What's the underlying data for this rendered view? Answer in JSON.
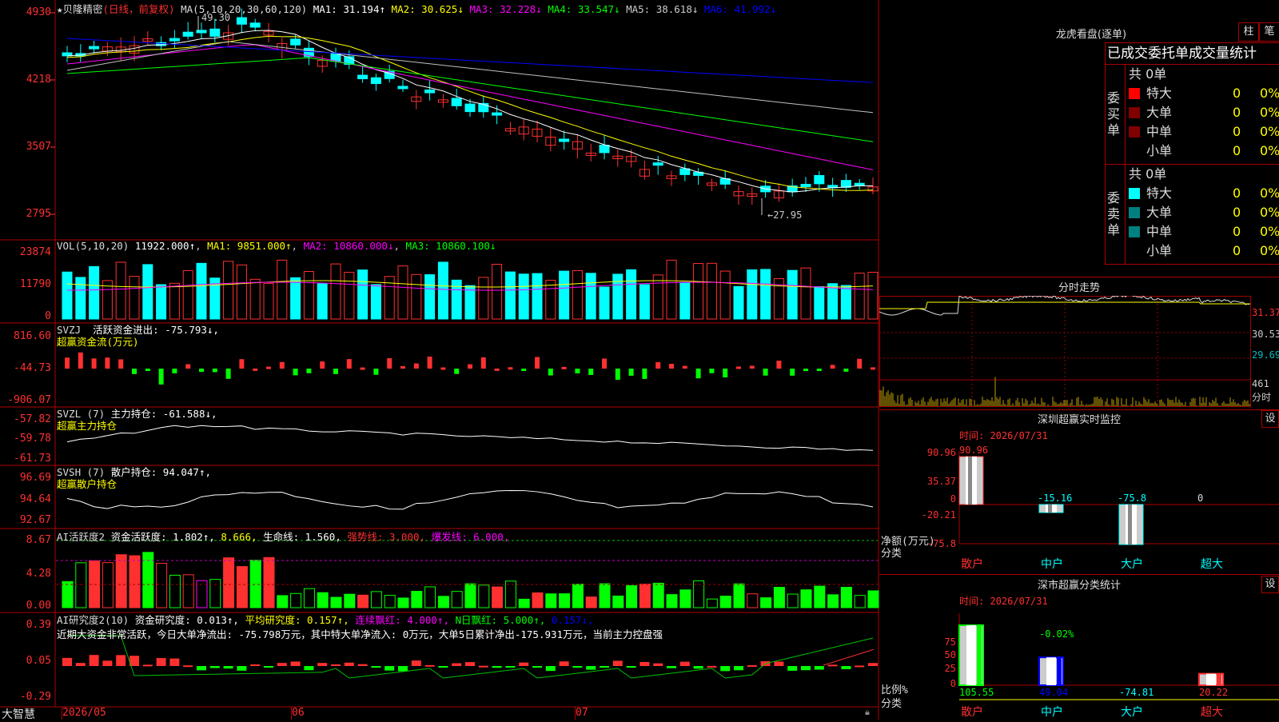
{
  "colors": {
    "up": "#ff3030",
    "down": "#00ffff",
    "grid": "#b00000",
    "ma1": "#ffffff",
    "ma2": "#ffff00",
    "ma3": "#ff00ff",
    "ma4": "#00ff00",
    "ma5": "#c0c0c0",
    "ma6": "#0000ff"
  },
  "kline": {
    "title": "★贝隆精密",
    "period": "(日线，前复权)",
    "ma_label": "MA(5,10,20,30,60,120)",
    "ma1": "MA1: 31.194↑",
    "ma2": "MA2: 30.625↓",
    "ma3": "MA3: 32.228↓",
    "ma4": "MA4: 33.547↓",
    "ma5": "MA5: 38.618↓",
    "ma6": "MA6: 41.992↓",
    "high_label": "49.30",
    "low_label": "27.95",
    "yaxis": [
      "4930",
      "4218",
      "3507",
      "2795"
    ]
  },
  "vol": {
    "label": "VOL(5,10,20)",
    "v": "11922.000↑",
    "ma1": "MA1: 9851.000↑",
    "ma2": "MA2: 10860.000↓",
    "ma3": "MA3: 10860.100↓",
    "yaxis": [
      "23874",
      "11790",
      "0"
    ]
  },
  "svzj": {
    "label": "SVZJ",
    "sub": "活跃资金进出: -75.793↓,",
    "name": "超赢资金流(万元)",
    "yaxis": [
      "816.60",
      "-44.73",
      "-906.07"
    ]
  },
  "svzl": {
    "label": "SVZL (7)",
    "sub": "主力持仓: -61.588↓,",
    "name": "超赢主力持仓",
    "yaxis": [
      "-57.82",
      "-59.78",
      "-61.73"
    ]
  },
  "svsh": {
    "label": "SVSH (7)",
    "sub": "散户持仓: 94.047↑,",
    "name": "超赢散户持仓",
    "yaxis": [
      "96.69",
      "94.64",
      "92.67"
    ]
  },
  "ai1": {
    "label": "AI活跃度2",
    "a": "资金活跃度: 1.802↑,",
    "b": "8.666,",
    "c": "生命线: 1.560,",
    "d": "强势线: 3.000,",
    "e": "爆发线: 6.000,",
    "yaxis": [
      "8.67",
      "4.28",
      "0.00"
    ]
  },
  "ai2": {
    "label": "AI研究度2(10)",
    "a": "资金研究度: 0.013↑,",
    "b": "平均研究度: 0.157↑,",
    "c": "连续飘红: 4.000↑,",
    "d": "N日飘红: 5.000↑,",
    "e": "0.157↓,",
    "yaxis": [
      "0.39",
      "0.05",
      "-0.29"
    ],
    "summary": "近期大资金非常活跃，今日大单净流出: -75.798万元，其中特大单净流入: 0万元，大单5日累计净出-175.931万元，当前主力控盘强"
  },
  "xaxis": {
    "bottom_left": "大智慧",
    "dates": [
      "2026/05",
      "06",
      "07"
    ]
  },
  "dragon": {
    "title": "龙虎看盘(逐单)",
    "btn1": "柱",
    "btn2": "笔",
    "sub": "已成交委托单成交量统计",
    "buy_title": "委买单",
    "sell_title": "委卖单",
    "buy_count": "共 0单",
    "sell_count": "共 0单",
    "rows": [
      {
        "name": "特大",
        "v": "0",
        "p": "0%"
      },
      {
        "name": "大单",
        "v": "0",
        "p": "0%"
      },
      {
        "name": "中单",
        "v": "0",
        "p": "0%"
      },
      {
        "name": "小单",
        "v": "0",
        "p": "0%"
      }
    ]
  },
  "intraday": {
    "title": "分时走势",
    "yaxis": [
      "31.37",
      "30.53",
      "29.69"
    ],
    "vol_label": "461",
    "vol_unit": "分时"
  },
  "monitor": {
    "title": "深圳超赢实时监控",
    "btn": "设",
    "time": "时间: 2026/07/31",
    "yaxis": [
      "90.96",
      "35.37",
      "0",
      "-20.21",
      "-75.8"
    ],
    "unit": "净额(万元)",
    "cat_label": "分类",
    "bars": [
      {
        "cat": "散户",
        "val": "90.96",
        "num": 90.96
      },
      {
        "cat": "中户",
        "val": "-15.16",
        "num": -15.16
      },
      {
        "cat": "大户",
        "val": "-75.8",
        "num": -75.8
      },
      {
        "cat": "超大",
        "val": "0",
        "num": 0
      }
    ]
  },
  "stats": {
    "title": "深市超赢分类统计",
    "btn": "设",
    "time": "时间: 2026/07/31",
    "yaxis": [
      "75",
      "50",
      "25",
      "0"
    ],
    "unit": "比例%",
    "cat_label": "分类",
    "pct_label": "-0.02%",
    "bars": [
      {
        "cat": "散户",
        "val": "105.55",
        "num": 105.55
      },
      {
        "cat": "中户",
        "val": "49.04",
        "num": 49.04
      },
      {
        "cat": "大户",
        "val": "-74.81",
        "num": -74.81
      },
      {
        "cat": "超大",
        "val": "20.22",
        "num": 20.22
      }
    ]
  }
}
